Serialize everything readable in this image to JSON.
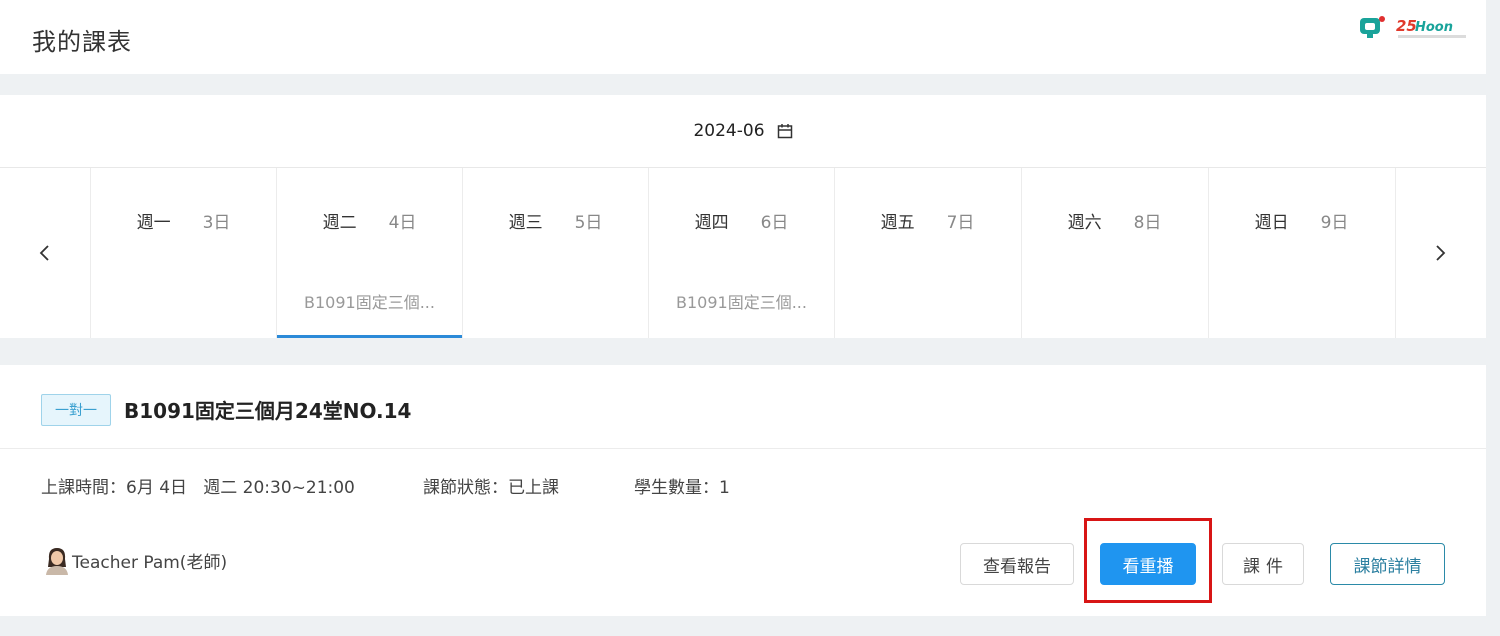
{
  "header": {
    "title": "我的課表",
    "logo_text": "25Hoon"
  },
  "calendar": {
    "month": "2024-06",
    "days": [
      {
        "name": "週一",
        "date": "3日",
        "event": ""
      },
      {
        "name": "週二",
        "date": "4日",
        "event": "B1091固定三個...",
        "active": true
      },
      {
        "name": "週三",
        "date": "5日",
        "event": ""
      },
      {
        "name": "週四",
        "date": "6日",
        "event": "B1091固定三個..."
      },
      {
        "name": "週五",
        "date": "7日",
        "event": ""
      },
      {
        "name": "週六",
        "date": "8日",
        "event": ""
      },
      {
        "name": "週日",
        "date": "9日",
        "event": ""
      }
    ]
  },
  "course": {
    "tag": "一對一",
    "title": "B1091固定三個月24堂NO.14",
    "time": "上課時間：6月 4日   週二 20:30~21:00",
    "status": "課節狀態：已上課",
    "students": "學生數量：1",
    "teacher": "Teacher Pam(老師)",
    "buttons": {
      "report": "查看報告",
      "replay": "看重播",
      "files": "課件",
      "detail": "課節詳情"
    }
  },
  "colors": {
    "accent": "#1f95f0",
    "active_underline": "#2b8ad8",
    "highlight": "#d81515"
  }
}
